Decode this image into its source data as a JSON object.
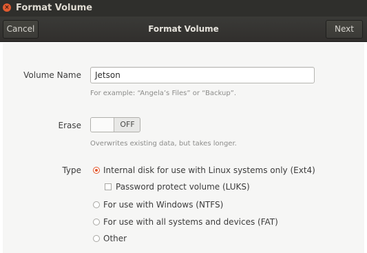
{
  "window": {
    "title": "Format Volume"
  },
  "headerbar": {
    "cancel_label": "Cancel",
    "title": "Format Volume",
    "next_label": "Next"
  },
  "form": {
    "volume_name": {
      "label": "Volume Name",
      "value": "Jetson",
      "hint": "For example: “Angela’s Files” or “Backup”."
    },
    "erase": {
      "label": "Erase",
      "state": "OFF",
      "hint": "Overwrites existing data, but takes longer."
    },
    "type": {
      "label": "Type",
      "options": [
        {
          "label": "Internal disk for use with Linux systems only (Ext4)",
          "selected": true
        },
        {
          "label": "For use with Windows (NTFS)",
          "selected": false
        },
        {
          "label": "For use with all systems and devices (FAT)",
          "selected": false
        },
        {
          "label": "Other",
          "selected": false
        }
      ],
      "password_protect": {
        "label": "Password protect volume (LUKS)",
        "checked": false
      }
    }
  },
  "colors": {
    "accent": "#e2572c",
    "headerbar": "#353432",
    "titlebar": "#2f2f2c"
  }
}
